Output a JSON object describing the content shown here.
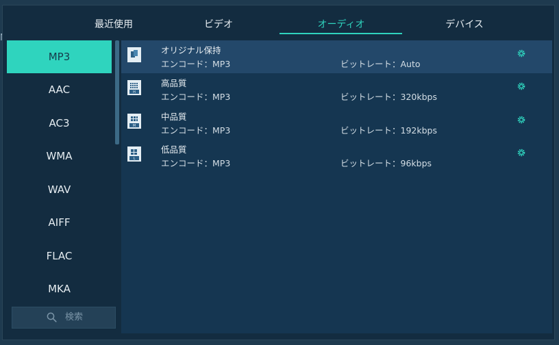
{
  "tabs": [
    {
      "label": "最近使用"
    },
    {
      "label": "ビデオ"
    },
    {
      "label": "オーディオ"
    },
    {
      "label": "デバイス"
    }
  ],
  "active_tab": "オーディオ",
  "background_hint": "N",
  "formats": [
    {
      "label": "MP3"
    },
    {
      "label": "AAC"
    },
    {
      "label": "AC3"
    },
    {
      "label": "WMA"
    },
    {
      "label": "WAV"
    },
    {
      "label": "AIFF"
    },
    {
      "label": "FLAC"
    },
    {
      "label": "MKA"
    }
  ],
  "selected_format": "MP3",
  "search": {
    "placeholder": "検索"
  },
  "presets": [
    {
      "name": "オリジナル保持",
      "encode": "エンコード：MP3",
      "bitrate": "ビットレート：Auto",
      "icon": "original-quality-icon"
    },
    {
      "name": "高品質",
      "encode": "エンコード：MP3",
      "bitrate": "ビットレート：320kbps",
      "icon": "high-quality-icon",
      "icon_letter": "H"
    },
    {
      "name": "中品質",
      "encode": "エンコード：MP3",
      "bitrate": "ビットレート：192kbps",
      "icon": "medium-quality-icon",
      "icon_letter": "M"
    },
    {
      "name": "低品質",
      "encode": "エンコード：MP3",
      "bitrate": "ビットレート：96kbps",
      "icon": "low-quality-icon",
      "icon_letter": "L"
    }
  ],
  "colors": {
    "accent": "#2fd4be",
    "panel": "#132c40",
    "content": "#153651",
    "selected_row": "#23486a"
  }
}
